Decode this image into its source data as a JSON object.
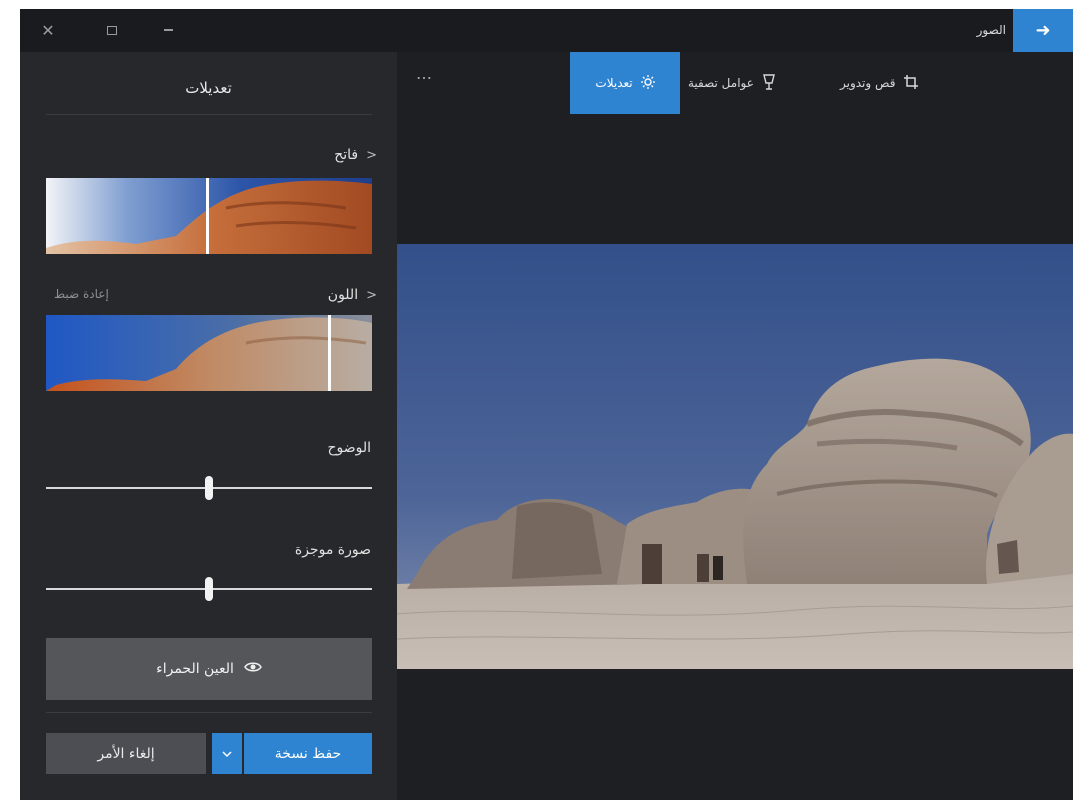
{
  "app": {
    "title": "الصور",
    "back_icon": "arrow-right-icon",
    "window_controls": [
      "close-icon",
      "maximize-icon",
      "minimize-icon"
    ]
  },
  "toolbar": {
    "items": [
      {
        "label": "قص وتدوير",
        "icon": "crop-rotate-icon",
        "active": false
      },
      {
        "label": "عوامل تصفية",
        "icon": "filters-icon",
        "active": false
      },
      {
        "label": "تعديلات",
        "icon": "adjust-sun-icon",
        "active": true
      }
    ],
    "more": "…"
  },
  "panel": {
    "title": "تعديلات",
    "light": {
      "label": "فاتح",
      "slider_value": 0.5
    },
    "color": {
      "label": "اللون",
      "reset": "إعادة ضبط",
      "slider_value": 0.87
    },
    "clarity": {
      "label": "الوضوح",
      "value": 0.5
    },
    "vignette": {
      "label": "صورة موجزة",
      "value": 0.5
    },
    "red_eye": {
      "label": "العين الحمراء",
      "icon": "eye-icon"
    },
    "save": {
      "label": "حفظ نسخة",
      "dropdown_icon": "chevron-down-icon"
    },
    "cancel": {
      "label": "إلغاء الأمر"
    }
  },
  "colors": {
    "accent": "#2f84d2",
    "background": "#1e1f23",
    "panel": "#27282c"
  }
}
